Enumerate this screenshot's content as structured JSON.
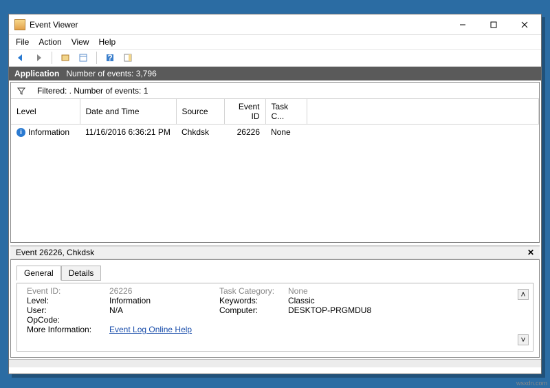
{
  "window": {
    "title": "Event Viewer"
  },
  "menubar": {
    "file": "File",
    "action": "Action",
    "view": "View",
    "help": "Help"
  },
  "status": {
    "appname": "Application",
    "count": "Number of events: 3,796"
  },
  "filter": {
    "text": "Filtered: . Number of events: 1"
  },
  "columns": {
    "level": "Level",
    "datetime": "Date and Time",
    "source": "Source",
    "eventid": "Event ID",
    "taskc": "Task C..."
  },
  "rows": [
    {
      "level": "Information",
      "datetime": "11/16/2016 6:36:21 PM",
      "source": "Chkdsk",
      "eventid": "26226",
      "taskc": "None"
    }
  ],
  "detail": {
    "header": "Event 26226, Chkdsk",
    "tab_general": "General",
    "tab_details": "Details",
    "eventid_k": "Event ID:",
    "eventid_v": "26226",
    "taskcat_k": "Task Category:",
    "taskcat_v": "None",
    "level_k": "Level:",
    "level_v": "Information",
    "keywords_k": "Keywords:",
    "keywords_v": "Classic",
    "user_k": "User:",
    "user_v": "N/A",
    "computer_k": "Computer:",
    "computer_v": "DESKTOP-PRGMDU8",
    "opcode_k": "OpCode:",
    "opcode_v": "",
    "moreinfo_k": "More Information:",
    "moreinfo_v": "Event Log Online Help"
  },
  "glyphs": {
    "info": "i",
    "close": "✕",
    "up": "˄",
    "down": "˅"
  },
  "watermark": "wsxdn.com"
}
